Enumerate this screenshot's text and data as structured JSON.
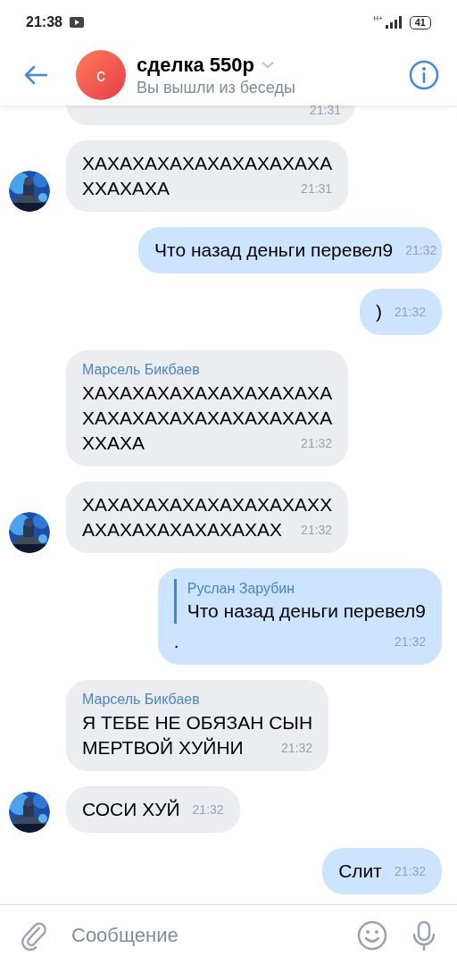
{
  "status_bar": {
    "time": "21:38",
    "network": "H+",
    "battery": "41"
  },
  "header": {
    "avatar_letter": "с",
    "title": "сделка 550р",
    "subtitle": "Вы вышли из беседы"
  },
  "messages": [
    {
      "kind": "incoming",
      "partial": true,
      "time": "21:31"
    },
    {
      "kind": "incoming",
      "avatar": true,
      "lines": [
        "ХАХАХАХАХАХАХАХАХАХА",
        "ХХАХАХА"
      ],
      "time": "21:31"
    },
    {
      "kind": "outgoing",
      "lines": [
        "Что назад деньги перевел9"
      ],
      "time": "21:32"
    },
    {
      "kind": "outgoing",
      "lines": [
        ")"
      ],
      "time": "21:32"
    },
    {
      "kind": "incoming",
      "sender": "Марсель Бикбаев",
      "lines": [
        "ХАХАХАХАХАХАХАХАХАХА",
        "ХАХАХАХАХАХАХАХАХАХА",
        "ХХАХА"
      ],
      "time": "21:32"
    },
    {
      "kind": "incoming",
      "avatar": true,
      "lines": [
        "ХАХАХАХАХАХАХАХАХАХХ",
        "АХАХАХАХАХАХАХАХ"
      ],
      "time": "21:32"
    },
    {
      "kind": "outgoing",
      "reply": {
        "author": "Руслан Зарубин",
        "text": "Что назад деньги перевел9"
      },
      "lines": [
        "."
      ],
      "time": "21:32"
    },
    {
      "kind": "incoming",
      "sender": "Марсель Бикбаев",
      "lines": [
        "Я ТЕБЕ НЕ ОБЯЗАН СЫН",
        "МЕРТВОЙ ХУЙНИ"
      ],
      "time": "21:32"
    },
    {
      "kind": "incoming",
      "avatar": true,
      "lines": [
        "СОСИ ХУЙ"
      ],
      "time": "21:32"
    },
    {
      "kind": "outgoing",
      "lines": [
        "Слит"
      ],
      "time": "21:32"
    }
  ],
  "composer": {
    "placeholder": "Сообщение"
  }
}
